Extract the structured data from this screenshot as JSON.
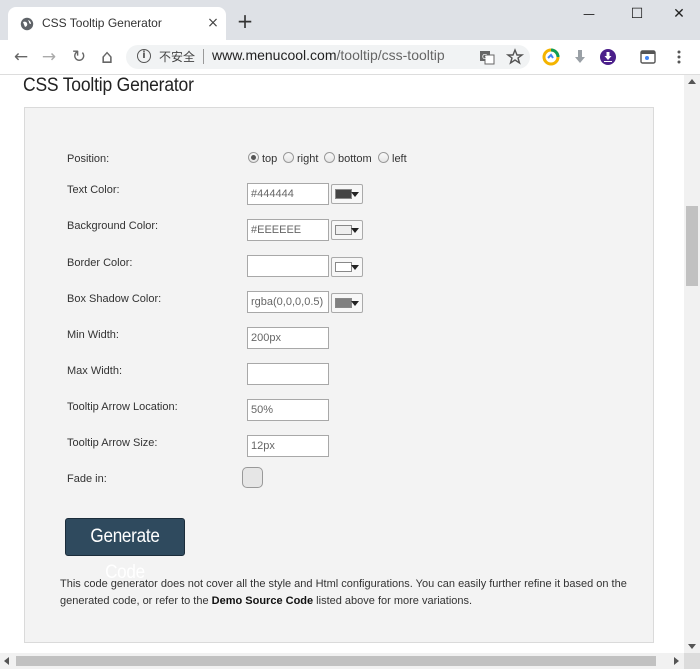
{
  "browser": {
    "tab_title": "CSS Tooltip Generator",
    "tab_close": "×",
    "new_tab": "+",
    "window": {
      "minimize": "—",
      "maximize": "☐",
      "close": "✕"
    },
    "nav": {
      "back": "←",
      "forward": "→",
      "reload": "↻",
      "home": "⌂"
    },
    "security_label": "不安全",
    "url_host": "www.menucool.com",
    "url_path": "/tooltip/css-tooltip"
  },
  "page": {
    "title": "CSS Tooltip Generator",
    "fields": {
      "position": {
        "label": "Position:",
        "options": [
          "top",
          "right",
          "bottom",
          "left"
        ],
        "selected": "top"
      },
      "text_color": {
        "label": "Text Color:",
        "value": "#444444",
        "swatch": "#444444"
      },
      "background_color": {
        "label": "Background Color:",
        "value": "#EEEEEE",
        "swatch": "#eeeeee"
      },
      "border_color": {
        "label": "Border Color:",
        "value": "",
        "swatch": "#ffffff"
      },
      "box_shadow_color": {
        "label": "Box Shadow Color:",
        "value": "rgba(0,0,0,0.5)",
        "swatch": "#808080"
      },
      "min_width": {
        "label": "Min Width:",
        "value": "200px"
      },
      "max_width": {
        "label": "Max Width:",
        "value": ""
      },
      "arrow_location": {
        "label": "Tooltip Arrow Location:",
        "value": "50%"
      },
      "arrow_size": {
        "label": "Tooltip Arrow Size:",
        "value": "12px"
      },
      "fade_in": {
        "label": "Fade in:",
        "checked": false
      }
    },
    "generate_button": "Generate Code",
    "note": {
      "text1": "This code generator does not cover all the style and Html configurations. You can easily further refine it based on the generated code, or refer to the ",
      "link": "Demo Source Code",
      "text2": " listed above for more variations."
    }
  },
  "colors": {
    "button_bg": "#2f4a5e",
    "panel_bg": "#f3f3f3"
  }
}
